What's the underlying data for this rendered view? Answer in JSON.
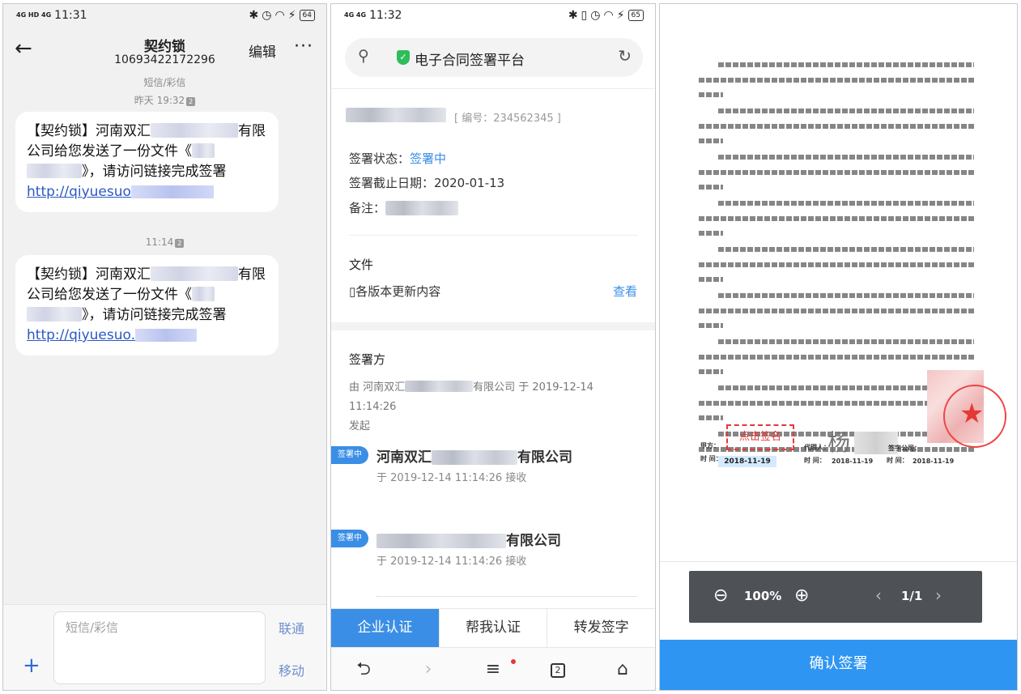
{
  "panel1": {
    "status": {
      "network": "4G HD 4G",
      "time": "11:31",
      "battery": "64"
    },
    "header": {
      "title": "契约锁",
      "number": "10693422172296",
      "edit": "编辑",
      "more": "···"
    },
    "sms_label": "短信/彩信",
    "messages": [
      {
        "time": "昨天 19:32",
        "sim": "2",
        "text_a": "【契约锁】河南双汇",
        "text_b": "有限公司给您发送了一份文件《",
        "text_c": "》，请访问链接完成签署",
        "link": "http://qiyuesuo"
      },
      {
        "time": "11:14",
        "sim": "2",
        "text_a": "【契约锁】河南双汇",
        "text_b": "有限公司给您发送了一份文件《",
        "text_c": "》，请访问链接完成签署",
        "link": "http://qiyuesuo."
      }
    ],
    "composer": {
      "placeholder": "短信/彩信",
      "plus": "+",
      "carrier_1": "联通",
      "carrier_2": "移动"
    }
  },
  "panel2": {
    "status": {
      "network": "4G 4G",
      "time": "11:32",
      "battery": "65"
    },
    "search": {
      "site": "电子合同签署平台"
    },
    "contract": {
      "number": "[ 编号：234562345 ]",
      "status_label": "签署状态：",
      "status_value": "签署中",
      "deadline_label": "签署截止日期：",
      "deadline_value": "2020-01-13",
      "remark_label": "备注："
    },
    "file": {
      "title": "文件",
      "name": "各版本更新内容",
      "view": "查看"
    },
    "signers": {
      "title": "签署方",
      "initiated_a": "由 河南双汇",
      "initiated_b": "有限公司 于 2019-12-14 11:14:26",
      "initiated_c": "发起",
      "list": [
        {
          "badge": "签署中",
          "name_a": "河南双汇",
          "name_b": "有限公司",
          "time": "于 2019-12-14 11:14:26 接收"
        },
        {
          "badge": "签署中",
          "name_b": "有限公司",
          "time": "于 2019-12-14 11:14:26 接收"
        }
      ]
    },
    "actions": [
      "企业认证",
      "帮我认证",
      "转发签字"
    ],
    "nav": {
      "tabs": "2"
    }
  },
  "panel3": {
    "sign_button": "点击签名",
    "dates": {
      "d1": "2018-11-19",
      "d2": "2018-11-19",
      "d3": "2018-11-19"
    },
    "labels": {
      "signer": "甲方：",
      "time": "时 间：",
      "agent": "代理人：",
      "time2": "时 间：",
      "time3": "时 间：",
      "company": "签字公司："
    },
    "handwriting": "杨",
    "zoom": {
      "value": "100%",
      "page": "1/1"
    },
    "confirm": "确认签署"
  }
}
